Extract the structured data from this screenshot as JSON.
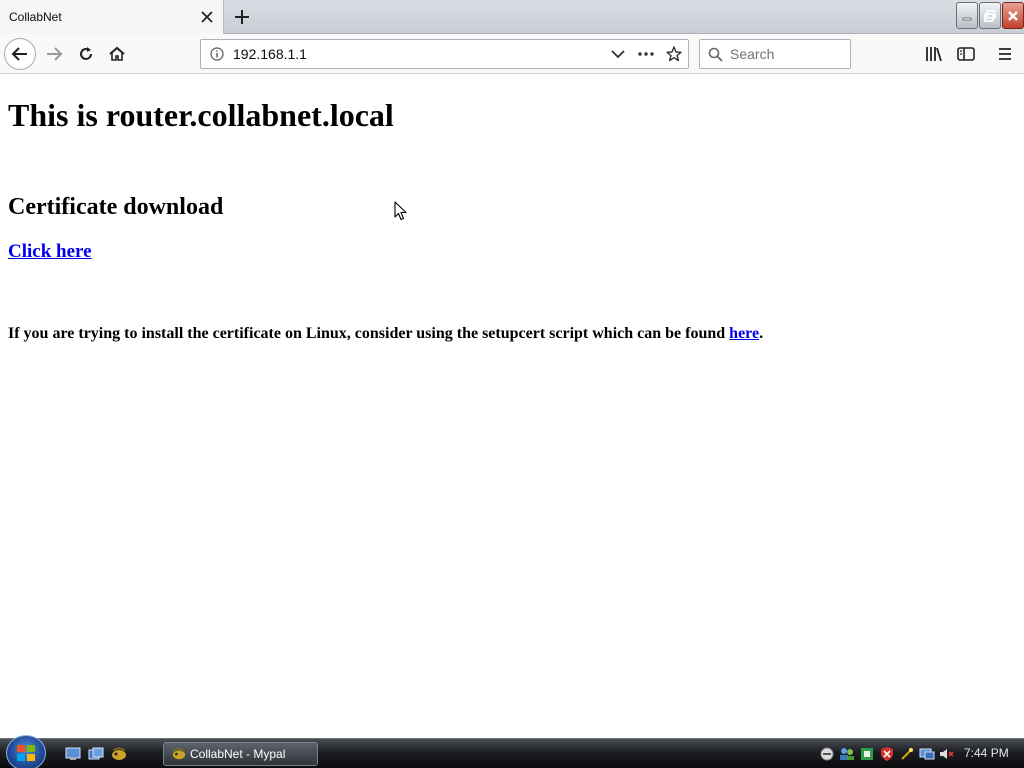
{
  "browser": {
    "tab_title": "CollabNet",
    "url": "192.168.1.1",
    "search_placeholder": "Search"
  },
  "page": {
    "heading": "This is router.collabnet.local",
    "subheading": "Certificate download",
    "download_link": "Click here",
    "linux_note": "If you are trying to install the certificate on Linux, consider using the setupcert script which can be found ",
    "linux_link": "here",
    "linux_note_end": "."
  },
  "taskbar": {
    "window_button": "CollabNet - Mypal",
    "clock": "7:44 PM"
  },
  "colors": {
    "link": "#0000ee",
    "close_button": "#c2412d"
  }
}
